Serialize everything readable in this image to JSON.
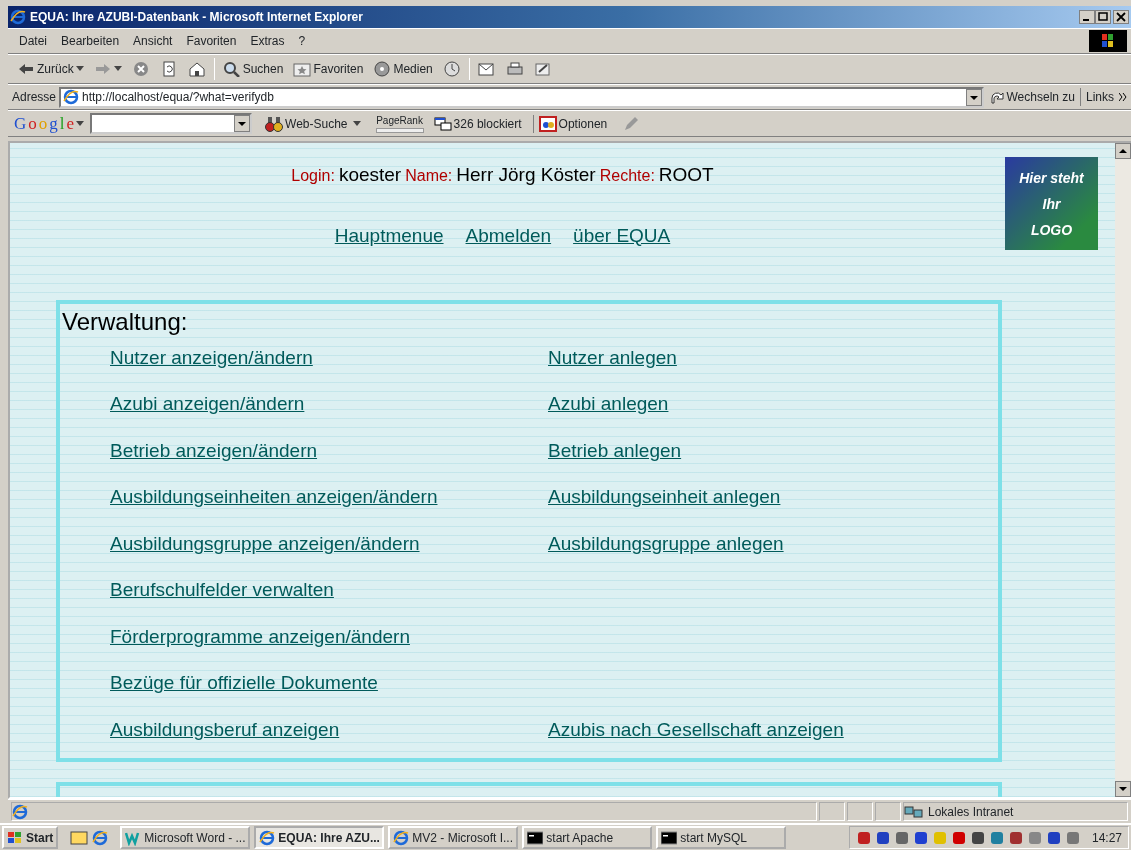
{
  "window": {
    "title": "EQUA: Ihre AZUBI-Datenbank - Microsoft Internet Explorer"
  },
  "menu": [
    "Datei",
    "Bearbeiten",
    "Ansicht",
    "Favoriten",
    "Extras",
    "?"
  ],
  "toolbar": [
    {
      "kind": "back",
      "label": "Zurück"
    },
    {
      "kind": "forward"
    },
    {
      "kind": "stop"
    },
    {
      "kind": "refresh"
    },
    {
      "kind": "home"
    },
    {
      "kind": "search",
      "label": "Suchen"
    },
    {
      "kind": "favorites",
      "label": "Favoriten"
    },
    {
      "kind": "media",
      "label": "Medien"
    },
    {
      "kind": "history"
    },
    {
      "kind": "mail"
    },
    {
      "kind": "print"
    },
    {
      "kind": "edit"
    }
  ],
  "address": {
    "label": "Adresse",
    "value": "http://localhost/equa/?what=verifydb",
    "go": "Wechseln zu",
    "links": "Links"
  },
  "google": {
    "logo": "Google",
    "search_button": "Web-Suche",
    "pagerank": "PageRank",
    "blocked": "326 blockiert",
    "options": "Optionen"
  },
  "user": {
    "login_label": "Login:",
    "login": "koester",
    "name_label": "Name:",
    "name": "Herr Jörg Köster",
    "rights_label": "Rechte:",
    "rights": "ROOT"
  },
  "nav": [
    "Hauptmenue",
    "Abmelden",
    "über EQUA"
  ],
  "logo": [
    "Hier steht",
    "Ihr",
    "LOGO"
  ],
  "sections": [
    {
      "title": "Verwaltung:",
      "rows": [
        [
          "Nutzer anzeigen/ändern",
          "Nutzer anlegen"
        ],
        [
          "Azubi anzeigen/ändern",
          "Azubi anlegen"
        ],
        [
          "Betrieb anzeigen/ändern",
          "Betrieb anlegen"
        ],
        [
          "Ausbildungseinheiten anzeigen/ändern",
          "Ausbildungseinheit anlegen"
        ],
        [
          "Ausbildungsgruppe anzeigen/ändern",
          "Ausbildungsgruppe anlegen"
        ],
        [
          "Berufschulfelder verwalten"
        ],
        [
          "Förderprogramme anzeigen/ändern"
        ],
        [
          "Bezüge für offizielle Dokumente"
        ],
        [
          "Ausbildungsberuf anzeigen",
          "Azubis nach Gesellschaft anzeigen"
        ]
      ]
    },
    {
      "kind": "cut_off"
    }
  ],
  "status_bar": {
    "zone": "Lokales Intranet"
  },
  "taskbar": {
    "start": "Start",
    "tasks": [
      {
        "label": "Microsoft Word - ...",
        "kind": "word",
        "selected": false
      },
      {
        "label": "EQUA: Ihre AZU...",
        "kind": "browser",
        "selected": true
      },
      {
        "label": "MV2 - Microsoft I...",
        "kind": "browser",
        "selected": false
      },
      {
        "label": "start Apache",
        "kind": "console",
        "selected": false
      },
      {
        "label": "start MySQL",
        "kind": "console",
        "selected": false
      }
    ],
    "clock": "14:27"
  }
}
